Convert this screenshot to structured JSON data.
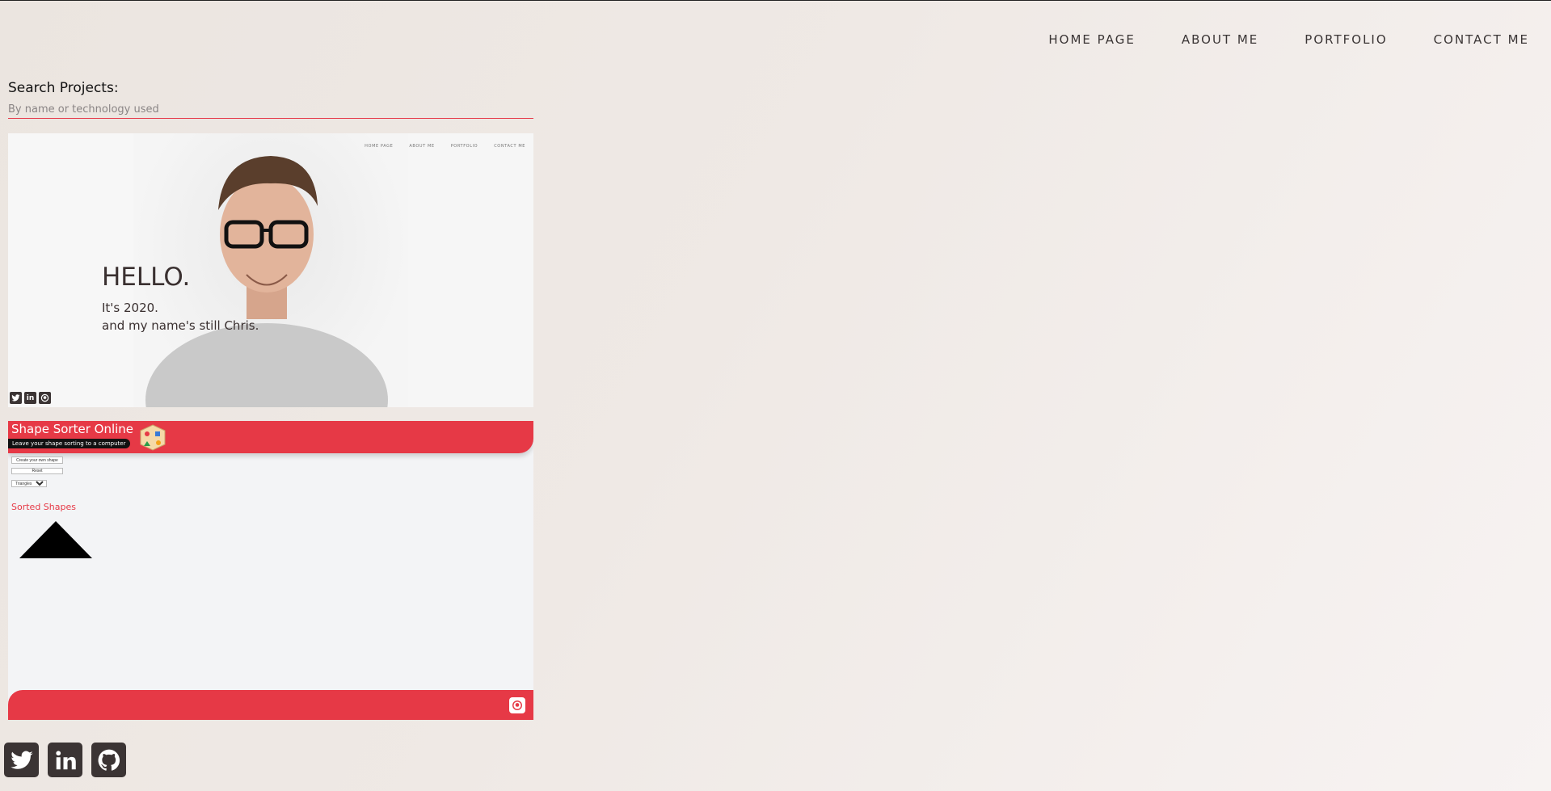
{
  "nav": {
    "items": [
      {
        "label": "HOME PAGE"
      },
      {
        "label": "ABOUT ME"
      },
      {
        "label": "PORTFOLIO"
      },
      {
        "label": "CONTACT ME"
      }
    ]
  },
  "search": {
    "label": "Search Projects:",
    "placeholder": "By name or technology used",
    "value": ""
  },
  "projects": [
    {
      "preview": {
        "nav": [
          "HOME PAGE",
          "ABOUT ME",
          "PORTFOLIO",
          "CONTACT ME"
        ],
        "heading": "HELLO.",
        "line1": "It's 2020.",
        "line2": "and my name's still Chris.",
        "social_icons": [
          "twitter-icon",
          "linkedin-icon",
          "github-icon"
        ]
      }
    },
    {
      "preview": {
        "title": "Shape Sorter Online",
        "tagline": "Leave your shape sorting to a computer",
        "create_button": "Create your own shape",
        "reset_button": "Reset",
        "select_value": "Triangles",
        "section_title": "Sorted Shapes",
        "accent_color": "#e63946"
      }
    }
  ],
  "social": {
    "icons": [
      "twitter-icon",
      "linkedin-icon",
      "github-icon"
    ],
    "color": "#3b3434"
  },
  "colors": {
    "accent": "#e63a4a",
    "text": "#3a3535"
  }
}
